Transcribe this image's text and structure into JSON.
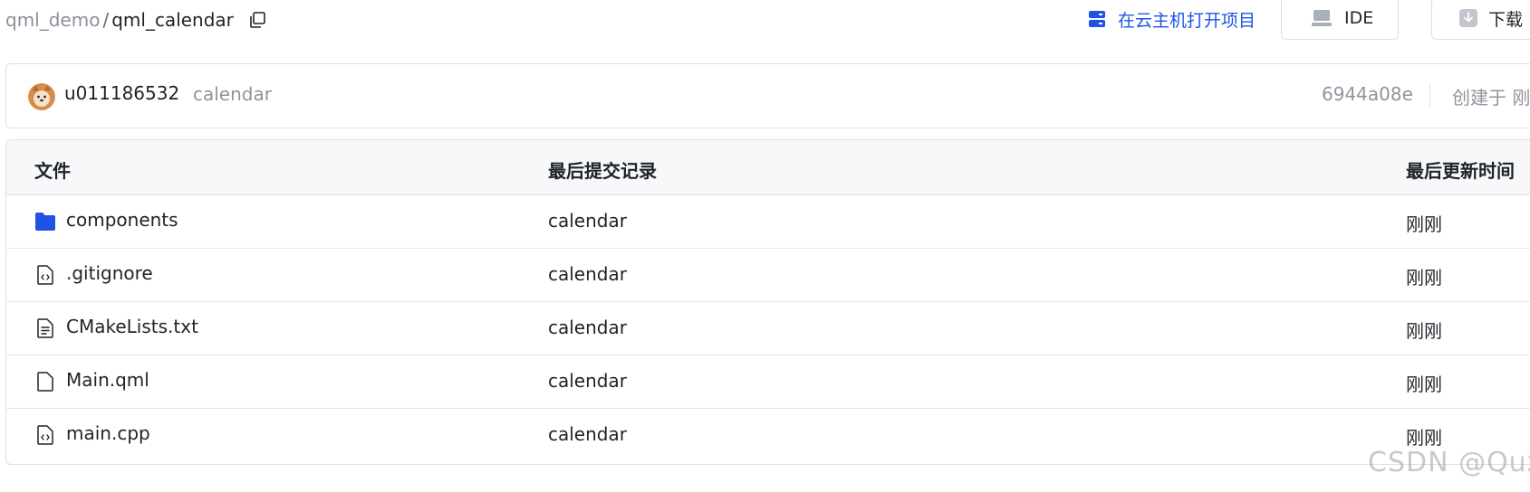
{
  "breadcrumb": {
    "parent": "qml_demo",
    "separator": "/",
    "current": "qml_calendar"
  },
  "toolbar": {
    "cloud_open_label": "在云主机打开项目",
    "ide_label": "IDE",
    "download_label": "下载"
  },
  "commit": {
    "user": "u011186532",
    "message": "calendar",
    "hash": "6944a08e",
    "created": "创建于 刚刚"
  },
  "table": {
    "headers": {
      "name": "文件",
      "last_commit": "最后提交记录",
      "updated": "最后更新时间"
    },
    "rows": [
      {
        "name": "components",
        "icon": "folder-icon",
        "commit": "calendar",
        "time": "刚刚"
      },
      {
        "name": ".gitignore",
        "icon": "code-file-icon",
        "commit": "calendar",
        "time": "刚刚"
      },
      {
        "name": "CMakeLists.txt",
        "icon": "text-file-icon",
        "commit": "calendar",
        "time": "刚刚"
      },
      {
        "name": "Main.qml",
        "icon": "file-icon",
        "commit": "calendar",
        "time": "刚刚"
      },
      {
        "name": "main.cpp",
        "icon": "code-file-icon",
        "commit": "calendar",
        "time": "刚刚"
      }
    ]
  },
  "watermark": "CSDN @Quz",
  "colors": {
    "accent": "#1e53e5",
    "muted": "#8f959e",
    "border": "#dee0e3",
    "header_bg": "#f7f8fa"
  }
}
